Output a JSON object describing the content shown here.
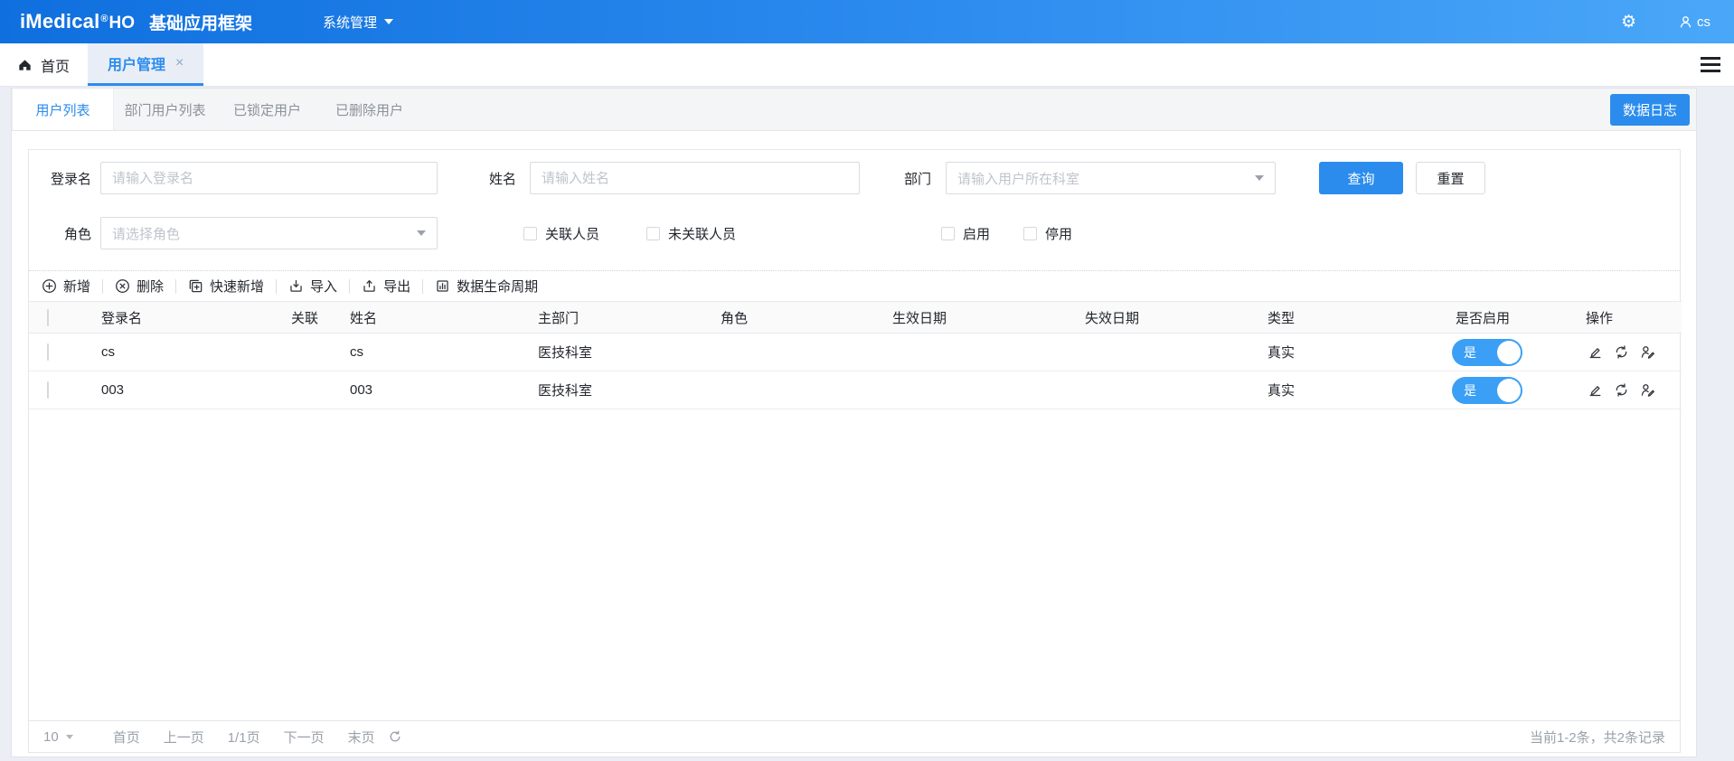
{
  "topbar": {
    "logo_main": "iMedical",
    "logo_reg": "®",
    "logo_sub": "HO",
    "app_title": "基础应用框架",
    "menu_system": "系统管理",
    "username": "cs"
  },
  "tabbar": {
    "home_label": "首页",
    "active_tab_label": "用户管理",
    "close_glyph": "×"
  },
  "panel": {
    "subtabs": [
      {
        "label": "用户列表",
        "active": true
      },
      {
        "label": "部门用户列表",
        "active": false
      },
      {
        "label": "已锁定用户",
        "active": false
      },
      {
        "label": "已删除用户",
        "active": false
      }
    ],
    "data_log_button": "数据日志"
  },
  "filters": {
    "login_label": "登录名",
    "login_placeholder": "请输入登录名",
    "name_label": "姓名",
    "name_placeholder": "请输入姓名",
    "dept_label": "部门",
    "dept_placeholder": "请输入用户所在科室",
    "role_label": "角色",
    "role_placeholder": "请选择角色",
    "assoc_label": "关联人员",
    "unassoc_label": "未关联人员",
    "enabled_label": "启用",
    "disabled_label": "停用",
    "search_button": "查询",
    "reset_button": "重置"
  },
  "toolbar": [
    {
      "icon": "plus-circle-icon",
      "label": "新增"
    },
    {
      "icon": "cross-circle-icon",
      "label": "删除"
    },
    {
      "icon": "square-plus-icon",
      "label": "快速新增"
    },
    {
      "icon": "import-icon",
      "label": "导入"
    },
    {
      "icon": "export-icon",
      "label": "导出"
    },
    {
      "icon": "lifecycle-icon",
      "label": "数据生命周期"
    }
  ],
  "table": {
    "columns": [
      "登录名",
      "关联",
      "姓名",
      "主部门",
      "角色",
      "生效日期",
      "失效日期",
      "类型",
      "是否启用",
      "操作"
    ],
    "rows": [
      {
        "login": "cs",
        "assoc": "",
        "name": "cs",
        "dept": "医技科室",
        "role": "",
        "valid_from": "",
        "valid_to": "",
        "type": "真实",
        "enabled": true,
        "enabled_label": "是"
      },
      {
        "login": "003",
        "assoc": "",
        "name": "003",
        "dept": "医技科室",
        "role": "",
        "valid_from": "",
        "valid_to": "",
        "type": "真实",
        "enabled": true,
        "enabled_label": "是"
      }
    ],
    "row_action_icons": [
      "edit-icon",
      "sync-icon",
      "user-pen-icon"
    ]
  },
  "pagination": {
    "page_size": "10",
    "first_label": "首页",
    "prev_label": "上一页",
    "page_info": "1/1页",
    "next_label": "下一页",
    "last_label": "末页",
    "summary": "当前1-2条，共2条记录"
  },
  "colors": {
    "primary": "#2b8ced",
    "topbar_gradient_start": "#0f6fde",
    "topbar_gradient_end": "#4aa7f8",
    "toggle_on": "#3ba0f5",
    "page_background": "#ebeef5",
    "subtab_bar_background": "#f4f5f6"
  }
}
